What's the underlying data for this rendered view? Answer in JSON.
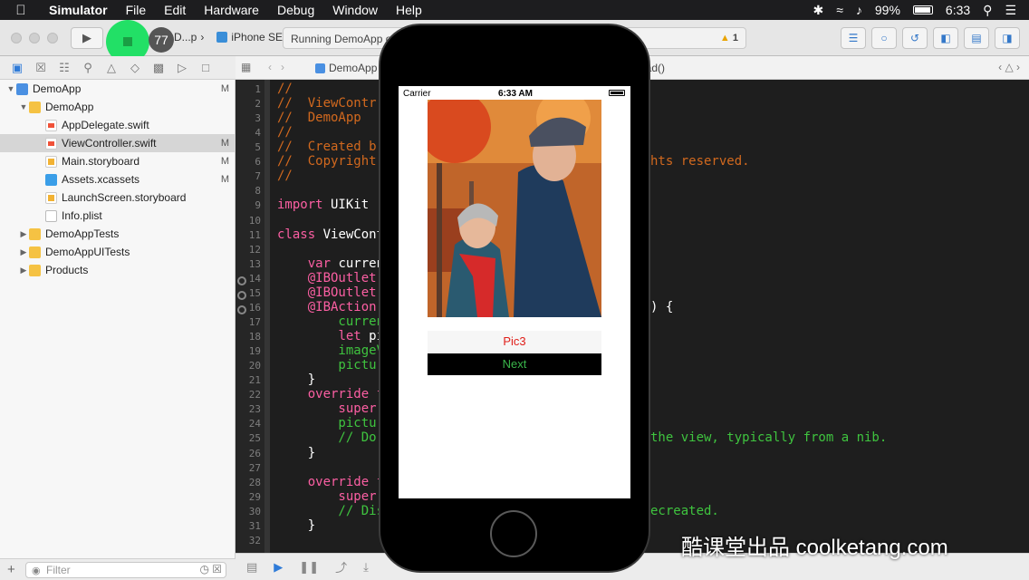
{
  "menubar": {
    "app": "Simulator",
    "items": [
      "File",
      "Edit",
      "Hardware",
      "Debug",
      "Window",
      "Help"
    ],
    "battery": "99%",
    "time": "6:33"
  },
  "toolbar": {
    "build_count": "77",
    "scheme": "D...p",
    "device": "iPhone SE",
    "status": "Running DemoApp o",
    "warning_count": "1"
  },
  "navigator": {
    "files": [
      {
        "name": "DemoApp",
        "badge": "M"
      },
      {
        "name": "DemoApp",
        "badge": ""
      },
      {
        "name": "AppDelegate.swift",
        "badge": ""
      },
      {
        "name": "ViewController.swift",
        "badge": "M"
      },
      {
        "name": "Main.storyboard",
        "badge": "M"
      },
      {
        "name": "Assets.xcassets",
        "badge": "M"
      },
      {
        "name": "LaunchScreen.storyboard",
        "badge": ""
      },
      {
        "name": "Info.plist",
        "badge": ""
      },
      {
        "name": "DemoAppTests",
        "badge": ""
      },
      {
        "name": "DemoAppUITests",
        "badge": ""
      },
      {
        "name": "Products",
        "badge": ""
      }
    ],
    "filter_placeholder": "Filter"
  },
  "jumpbar": {
    "crumb": "DemoApp",
    "func": "oad()"
  },
  "editor": {
    "line_numbers": [
      "1",
      "2",
      "3",
      "4",
      "5",
      "6",
      "7",
      "8",
      "9",
      "10",
      "11",
      "12",
      "13",
      "14",
      "15",
      "16",
      "17",
      "18",
      "19",
      "20",
      "21",
      "22",
      "23",
      "24",
      "25",
      "26",
      "27",
      "28",
      "29",
      "30",
      "31",
      "32"
    ],
    "lines": [
      {
        "text": "//",
        "cls": "cm"
      },
      {
        "text": "//  ViewContr",
        "cls": "cm"
      },
      {
        "text": "//  DemoApp",
        "cls": "cm"
      },
      {
        "text": "//",
        "cls": "cm"
      },
      {
        "text": "//  Created b",
        "cls": "cm"
      },
      {
        "text": "//  Copyright",
        "cls": "cm"
      },
      {
        "text": "//",
        "cls": "cm"
      },
      {
        "text": "",
        "cls": ""
      },
      {
        "text": "import UIKit",
        "cls": "imp"
      },
      {
        "text": "",
        "cls": ""
      },
      {
        "text": "class ViewCont",
        "cls": "cls"
      },
      {
        "text": "",
        "cls": ""
      },
      {
        "text": "    var curren",
        "cls": "var"
      },
      {
        "text": "    @IBOutlet",
        "cls": "kw"
      },
      {
        "text": "    @IBOutlet",
        "cls": "kw"
      },
      {
        "text": "    @IBAction",
        "cls": "kw"
      },
      {
        "text": "        curren",
        "cls": "gr"
      },
      {
        "text": "        let pi",
        "cls": "let"
      },
      {
        "text": "        imageV",
        "cls": "gr"
      },
      {
        "text": "        pictur",
        "cls": "gr"
      },
      {
        "text": "    }",
        "cls": ""
      },
      {
        "text": "    override f",
        "cls": "kw"
      },
      {
        "text": "        super.",
        "cls": "kw"
      },
      {
        "text": "        pictur",
        "cls": "gr"
      },
      {
        "text": "        // Do",
        "cls": "gr"
      },
      {
        "text": "    }",
        "cls": ""
      },
      {
        "text": "",
        "cls": ""
      },
      {
        "text": "    override f",
        "cls": "kw"
      },
      {
        "text": "        super.",
        "cls": "kw"
      },
      {
        "text": "        // Dis",
        "cls": "gr"
      },
      {
        "text": "    }",
        "cls": ""
      },
      {
        "text": "",
        "cls": ""
      }
    ],
    "tails": [
      {
        "line": 6,
        "text": "hts reserved.",
        "cls": "cm"
      },
      {
        "line": 16,
        "text": ") {",
        "cls": ""
      },
      {
        "line": 25,
        "text": "the view, typically from a nib.",
        "cls": "gr"
      },
      {
        "line": 30,
        "text": "ecreated.",
        "cls": "gr"
      }
    ]
  },
  "simulator": {
    "carrier": "Carrier",
    "time": "6:33 AM",
    "label": "Pic3",
    "button": "Next"
  },
  "watermark": "酷课堂出品 coolketang.com",
  "colors": {
    "label_text": "#e0201b",
    "button_text": "#39b54a",
    "stop_highlight": "#22e066",
    "comment": "#d2691e",
    "keyword": "#fc5fa3"
  }
}
